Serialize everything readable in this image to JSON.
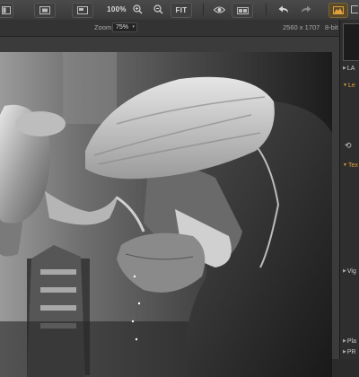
{
  "toolbar": {
    "zoom_percent": "100%",
    "fit_label": "FIT"
  },
  "infobar": {
    "zoom_label": "Zoom",
    "zoom_value": "75%",
    "dimensions": "2560 x 1707",
    "bit_depth": "8-bit"
  },
  "panel": {
    "sections": [
      {
        "label": "LA",
        "state": "collapsed"
      },
      {
        "label": "Le",
        "state": "expanded",
        "accent": true
      },
      {
        "label": "Tex",
        "state": "expanded",
        "accent": true
      },
      {
        "label": "Vig",
        "state": "collapsed"
      },
      {
        "label": "Pla",
        "state": "collapsed"
      },
      {
        "label": "PR",
        "state": "collapsed"
      }
    ]
  },
  "colors": {
    "accent": "#e0a03c",
    "toolbar_bg": "#444444",
    "panel_bg": "#2e2e2e"
  }
}
